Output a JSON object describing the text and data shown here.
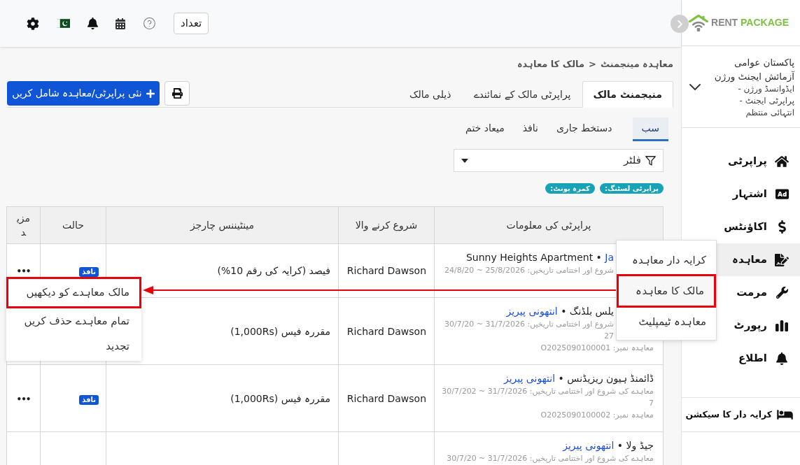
{
  "logo": {
    "text": "RENT",
    "accent": "PACKAGE"
  },
  "account": {
    "name": "پاکستان عوامی آزمائش ایجنٹ ورژن",
    "role": "ایڈوانسڈ ورژن - پراپرٹی ایجنٹ - انتہائی منتظم"
  },
  "nav": [
    {
      "label": "پراپرٹی",
      "selected": false
    },
    {
      "label": "اشتہار",
      "selected": false
    },
    {
      "label": "اکاؤنٹس",
      "selected": false
    },
    {
      "label": "معاہدہ",
      "selected": true
    },
    {
      "label": "مرمت",
      "selected": false
    },
    {
      "label": "رپورٹ",
      "selected": false
    },
    {
      "label": "اطلاع",
      "selected": false
    }
  ],
  "tenant_section": {
    "label": "کرایہ دار کا سیکشن"
  },
  "contract_menu": [
    {
      "label": "کرایہ دار معاہدہ",
      "highlighted": false
    },
    {
      "label": "مالک کا معاہدہ",
      "highlighted": true
    },
    {
      "label": "معاہدہ ٹیمپلیٹ",
      "highlighted": false
    }
  ],
  "top_bar": {
    "count_button": "تعداد"
  },
  "breadcrumb": {
    "items": [
      "معاہدہ مینجمنٹ",
      "مالک کا معاہدہ"
    ],
    "separator": ">"
  },
  "tabs": [
    {
      "label": "منیجمنٹ مالک",
      "selected": true
    },
    {
      "label": "پراپرٹی مالک کے نمائندے",
      "selected": false
    },
    {
      "label": "ذیلی مالک",
      "selected": false
    }
  ],
  "add_button": "نئی پراپرٹی/معاہدہ شامل کریں",
  "status_tabs": [
    {
      "label": "سب",
      "selected": true
    },
    {
      "label": "دستخط جاری",
      "selected": false
    },
    {
      "label": "نافذ",
      "selected": false
    },
    {
      "label": "میعاد ختم",
      "selected": false
    }
  ],
  "filter": {
    "label": "فلٹر"
  },
  "tags": [
    "پراپرٹی لسٹنگ:",
    "کمرہ یونٹ:"
  ],
  "table": {
    "columns": [
      "پراپرٹی کی معلومات",
      "شروع کرنے والا",
      "مینٹیننس چارجز",
      "حالت",
      "مزید"
    ],
    "rows": [
      {
        "title": "Sunny Heights Apartment •",
        "owner": "Ja",
        "dates": "شروع اور اختتامی تاریخیں: 25/8/2026 ~ 24/8/20",
        "initiator": "Richard Dawson",
        "maintenance": "فیصد (کرایہ کی رقم 10%)",
        "status": "نافذ",
        "more": "•••"
      },
      {
        "title": "یلس بلڈنگ •",
        "owner": "انتھونی پیریز",
        "dates": "شروع اور اختتامی تاریخیں: 31/7/2026 ~ 30/7/2027",
        "contract_no": "معاہدہ نمبر: O2025090100001",
        "initiator": "Richard Dawson",
        "maintenance": "مقررہ فیس (1,000Rs)"
      },
      {
        "title": "ڈائمنڈ ہیون ریزیڈنس •",
        "owner": "انتھونی پیریز",
        "dates": "معاہدے کی شروع اور اختتامی تاریخیں: 31/7/2026 ~ 30/7/2027",
        "contract_no": "معاہدہ نمبر: O2025090100002",
        "initiator": "Richard Dawson",
        "maintenance": "مقررہ فیس (1,000Rs)",
        "status": "نافذ",
        "more": "•••"
      },
      {
        "title": "جیڈ ولا •",
        "owner": "انتھونی پیریز",
        "dates": "معاہدے کی شروع اور اختتامی تاریخیں: 31/7/2026 ~ 30/7/20"
      }
    ]
  },
  "row_menu": [
    {
      "label": "مالک معاہدے کو دیکھیں",
      "highlighted": true
    },
    {
      "label": "تمام معاہدے حذف کریں",
      "highlighted": false
    },
    {
      "label": "تجدید",
      "highlighted": false
    }
  ]
}
